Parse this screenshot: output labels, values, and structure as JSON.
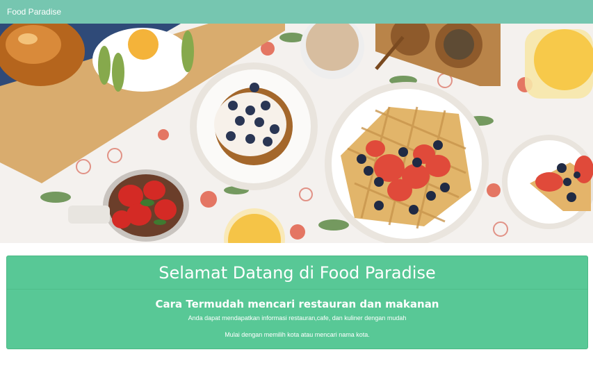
{
  "navbar": {
    "brand": "Food Paradise",
    "color": "#76c6b0"
  },
  "hero": {
    "image": "breakfast-table-photo"
  },
  "jumbotron": {
    "title": "Selamat Datang di Food Paradise",
    "subtitle": "Cara Termudah mencari restauran dan makanan",
    "text_1": "Anda dapat mendapatkan informasi restauran,cafe, dan kuliner dengan mudah",
    "text_2": "Mulai dengan memilih kota atau mencari nama kota.",
    "color": "#58c896"
  }
}
